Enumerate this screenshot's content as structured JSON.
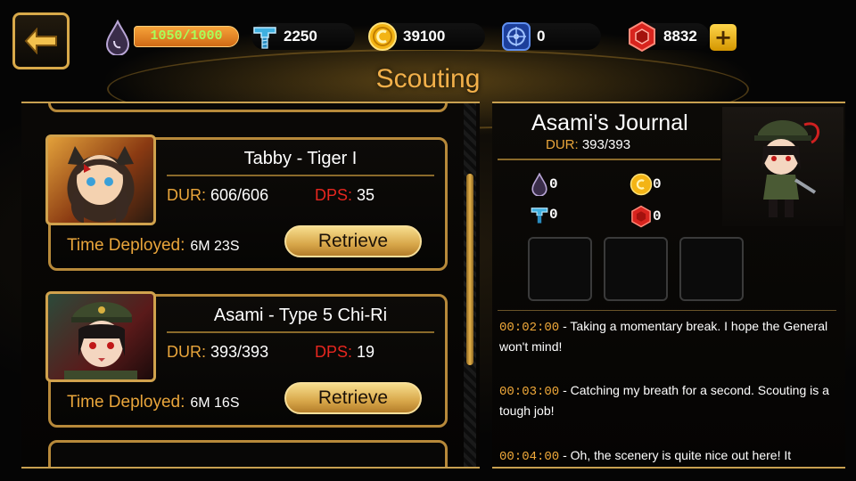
{
  "top_bar": {
    "energy": {
      "text": "1050/1000",
      "icon": "dark-drop-icon"
    },
    "bolts": {
      "value": "2250",
      "icon": "bolt-icon"
    },
    "coins": {
      "value": "39100",
      "icon": "gold-coin-icon"
    },
    "cores": {
      "value": "0",
      "icon": "blue-core-icon"
    },
    "gems": {
      "value": "8832",
      "icon": "red-gem-icon"
    },
    "plus_label": "+",
    "back_icon": "back-arrow-icon"
  },
  "page_title": "Scouting",
  "deployed_list": [
    {
      "name": "Tabby - Tiger I",
      "dur_label": "DUR:",
      "dur_value": "606/606",
      "dps_label": "DPS:",
      "dps_value": "35",
      "time_label": "Time Deployed:",
      "time_value": "6M 23S",
      "retrieve_label": "Retrieve"
    },
    {
      "name": "Asami - Type 5 Chi-Ri",
      "dur_label": "DUR:",
      "dur_value": "393/393",
      "dps_label": "DPS:",
      "dps_value": "19",
      "time_label": "Time Deployed:",
      "time_value": "6M 16S",
      "retrieve_label": "Retrieve"
    }
  ],
  "journal": {
    "title": "Asami's Journal",
    "dur_label": "DUR:",
    "dur_value": "393/393",
    "loot": {
      "drops": "0",
      "coins": "0",
      "bolts": "0",
      "gems": "0"
    },
    "log": [
      {
        "time": "00:02:00",
        "text": " - Taking a momentary break. I hope the General won't mind!"
      },
      {
        "time": "00:03:00",
        "text": " - Catching my breath for a second. Scouting is a tough job!"
      },
      {
        "time": "00:04:00",
        "text": " - Oh, the scenery is quite nice out here! It"
      }
    ]
  },
  "colors": {
    "accent_gold": "#e9a53b",
    "dps_red": "#e6261f",
    "energy_text": "#a8ff5a",
    "title": "#f2b04a"
  }
}
